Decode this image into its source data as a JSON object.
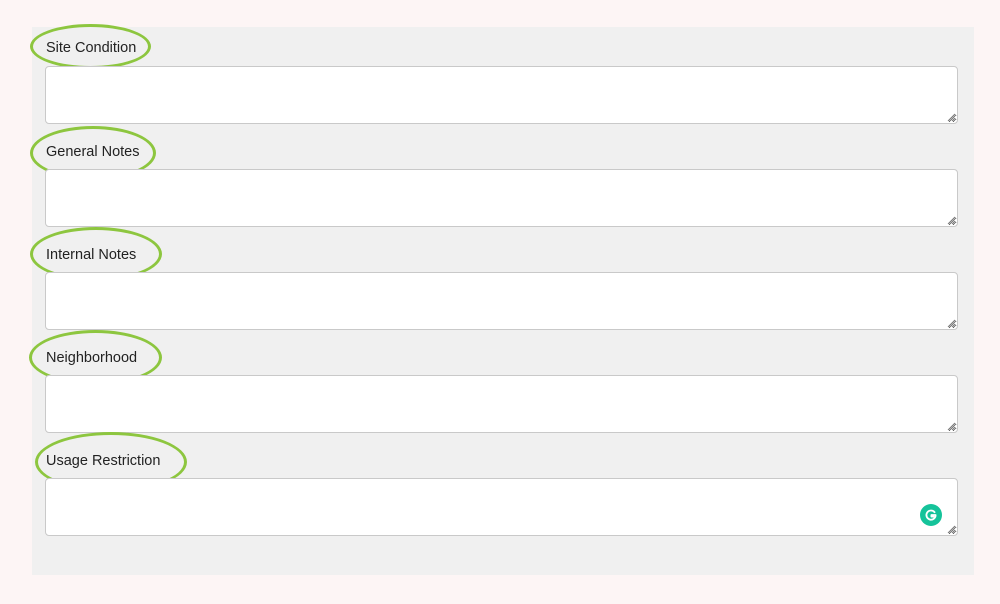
{
  "form": {
    "fields": [
      {
        "label": "Site Condition",
        "value": ""
      },
      {
        "label": "General Notes",
        "value": ""
      },
      {
        "label": "Internal Notes",
        "value": ""
      },
      {
        "label": "Neighborhood",
        "value": ""
      },
      {
        "label": "Usage Restriction",
        "value": ""
      }
    ]
  },
  "colors": {
    "page_background": "#fdf5f5",
    "panel_background": "#f0f0f0",
    "highlight_ring": "#8dc63f",
    "grammarly_badge": "#15c39a"
  },
  "icons": {
    "resize_handle": "resize-grip-icon",
    "assistant_badge": "grammarly-icon"
  }
}
